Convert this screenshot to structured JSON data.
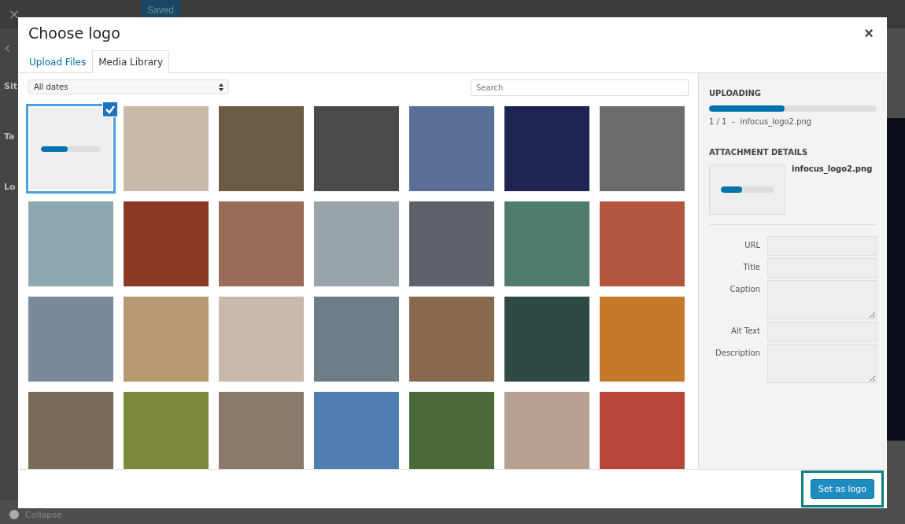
{
  "background": {
    "close": "×",
    "saved_button": "Saved",
    "back": "‹",
    "labels": [
      "Sit",
      "Ta",
      "Lo"
    ],
    "collapse": "Collapse"
  },
  "modal": {
    "title": "Choose logo",
    "close": "×",
    "tabs": [
      {
        "label": "Upload Files",
        "selected": false
      },
      {
        "label": "Media Library",
        "selected": true
      }
    ],
    "filter": {
      "value": "All dates"
    },
    "search": {
      "placeholder": "Search"
    },
    "media": [
      {
        "kind": "upload",
        "level": 0.45,
        "selected": true
      },
      {
        "kind": "photo",
        "selected": false
      },
      {
        "kind": "photo",
        "selected": false
      },
      {
        "kind": "photo",
        "selected": false
      },
      {
        "kind": "photo",
        "selected": false
      },
      {
        "kind": "photo",
        "selected": false
      },
      {
        "kind": "photo",
        "selected": false
      },
      {
        "kind": "photo",
        "selected": false
      },
      {
        "kind": "photo",
        "selected": false
      },
      {
        "kind": "photo",
        "selected": false
      },
      {
        "kind": "photo",
        "selected": false
      },
      {
        "kind": "photo",
        "selected": false
      },
      {
        "kind": "photo",
        "selected": false
      },
      {
        "kind": "photo",
        "selected": false
      },
      {
        "kind": "photo",
        "selected": false
      },
      {
        "kind": "photo",
        "selected": false
      },
      {
        "kind": "photo",
        "selected": false
      },
      {
        "kind": "photo",
        "selected": false
      },
      {
        "kind": "photo",
        "selected": false
      },
      {
        "kind": "photo",
        "selected": false
      },
      {
        "kind": "photo",
        "selected": false
      },
      {
        "kind": "photo",
        "selected": false
      },
      {
        "kind": "photo",
        "selected": false
      },
      {
        "kind": "photo",
        "selected": false
      },
      {
        "kind": "photo",
        "selected": false
      },
      {
        "kind": "photo",
        "selected": false
      },
      {
        "kind": "photo",
        "selected": false
      },
      {
        "kind": "photo",
        "selected": false
      }
    ],
    "sidebar": {
      "uploading": {
        "heading": "UPLOADING",
        "level": 0.45,
        "count": "1 / 1",
        "dash": "–",
        "filename": "infocus_logo2.png"
      },
      "details": {
        "heading": "ATTACHMENT DETAILS",
        "thumbnail": {
          "level": 0.4
        },
        "filename": "infocus_logo2.png"
      },
      "fields": [
        {
          "label": "URL",
          "kind": "input"
        },
        {
          "label": "Title",
          "kind": "input"
        },
        {
          "label": "Caption",
          "kind": "textarea"
        },
        {
          "label": "Alt Text",
          "kind": "input"
        },
        {
          "label": "Description",
          "kind": "textarea"
        }
      ]
    },
    "footer": {
      "button": "Set as logo",
      "highlighted": true
    }
  }
}
